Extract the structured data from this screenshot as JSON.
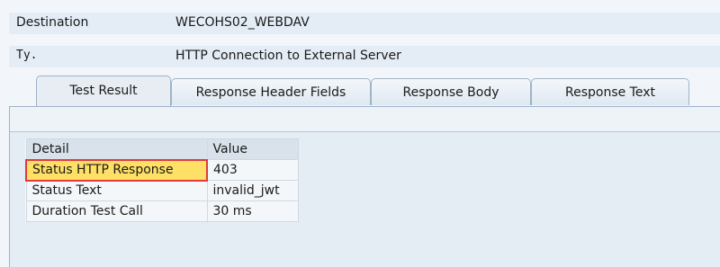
{
  "header": {
    "destination_label": "Destination",
    "destination_value": "WECOHS02_WEBDAV",
    "type_label": "Ty.",
    "type_value": "HTTP Connection to External Server"
  },
  "tabs": [
    {
      "label": "Test Result",
      "active": true
    },
    {
      "label": "Response Header Fields",
      "active": false
    },
    {
      "label": "Response Body",
      "active": false
    },
    {
      "label": "Response Text",
      "active": false
    }
  ],
  "table": {
    "columns": [
      "Detail",
      "Value"
    ],
    "rows": [
      {
        "detail": "Status HTTP Response",
        "value": "403"
      },
      {
        "detail": "Status Text",
        "value": "invalid_jwt"
      },
      {
        "detail": "Duration Test Call",
        "value": "30 ms"
      }
    ]
  },
  "colors": {
    "accent_highlight": "#ffe066",
    "focus_border": "#e03a3a"
  }
}
